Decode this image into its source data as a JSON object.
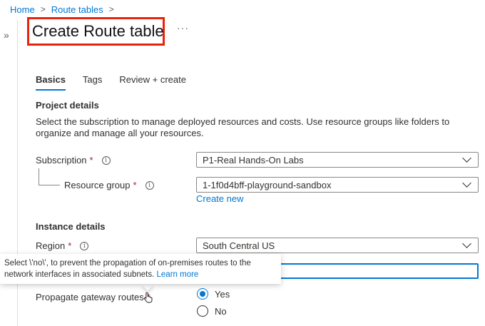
{
  "breadcrumb": {
    "items": [
      "Home",
      "Route tables"
    ],
    "separator": ">"
  },
  "page": {
    "title": "Create Route table",
    "more": "···",
    "collapse": "»"
  },
  "tabs": [
    {
      "label": "Basics",
      "active": true
    },
    {
      "label": "Tags",
      "active": false
    },
    {
      "label": "Review + create",
      "active": false
    }
  ],
  "project": {
    "title": "Project details",
    "description": "Select the subscription to manage deployed resources and costs. Use resource groups like folders to organize and manage all your resources.",
    "subscription_label": "Subscription",
    "subscription_value": "P1-Real Hands-On Labs",
    "resource_group_label": "Resource group",
    "resource_group_value": "1-1f0d4bff-playground-sandbox",
    "create_new": "Create new"
  },
  "instance": {
    "title": "Instance details",
    "region_label": "Region",
    "region_value": "South Central US",
    "name_value": "",
    "propagate_label": "Propagate gateway routes",
    "yes": "Yes",
    "no": "No",
    "selected": "Yes"
  },
  "tooltip": {
    "text": "Select \\'no\\', to prevent the propagation of on-premises routes to the network interfaces in associated subnets.",
    "link": "Learn more"
  },
  "colors": {
    "accent": "#0078d4",
    "highlight_box": "#e8230a",
    "required": "#a4262c"
  },
  "icons": {
    "info": "info-icon",
    "chevron": "chevron-down-icon",
    "cursor": "hand-pointer-icon"
  }
}
